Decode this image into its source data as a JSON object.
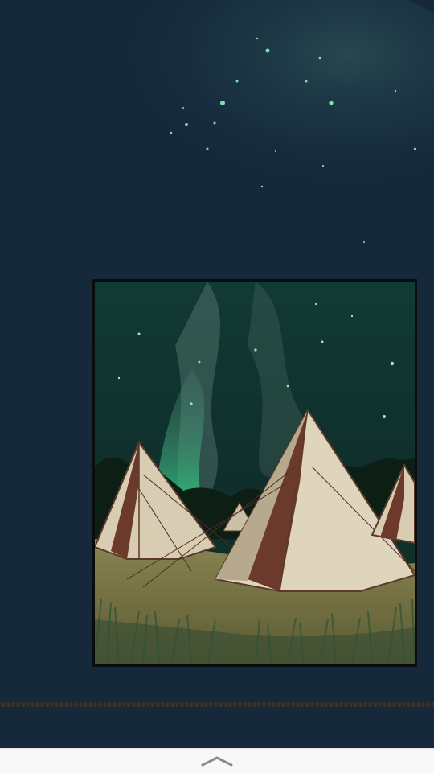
{
  "reader": {
    "scene": "night-camp-panel",
    "colors": {
      "background": "#15293a",
      "aurora": "#2fae7a",
      "tent": "#d9cdb6",
      "grass": "#5c6b3e"
    }
  },
  "bottom_bar": {
    "icon": "chevron-up-icon"
  }
}
